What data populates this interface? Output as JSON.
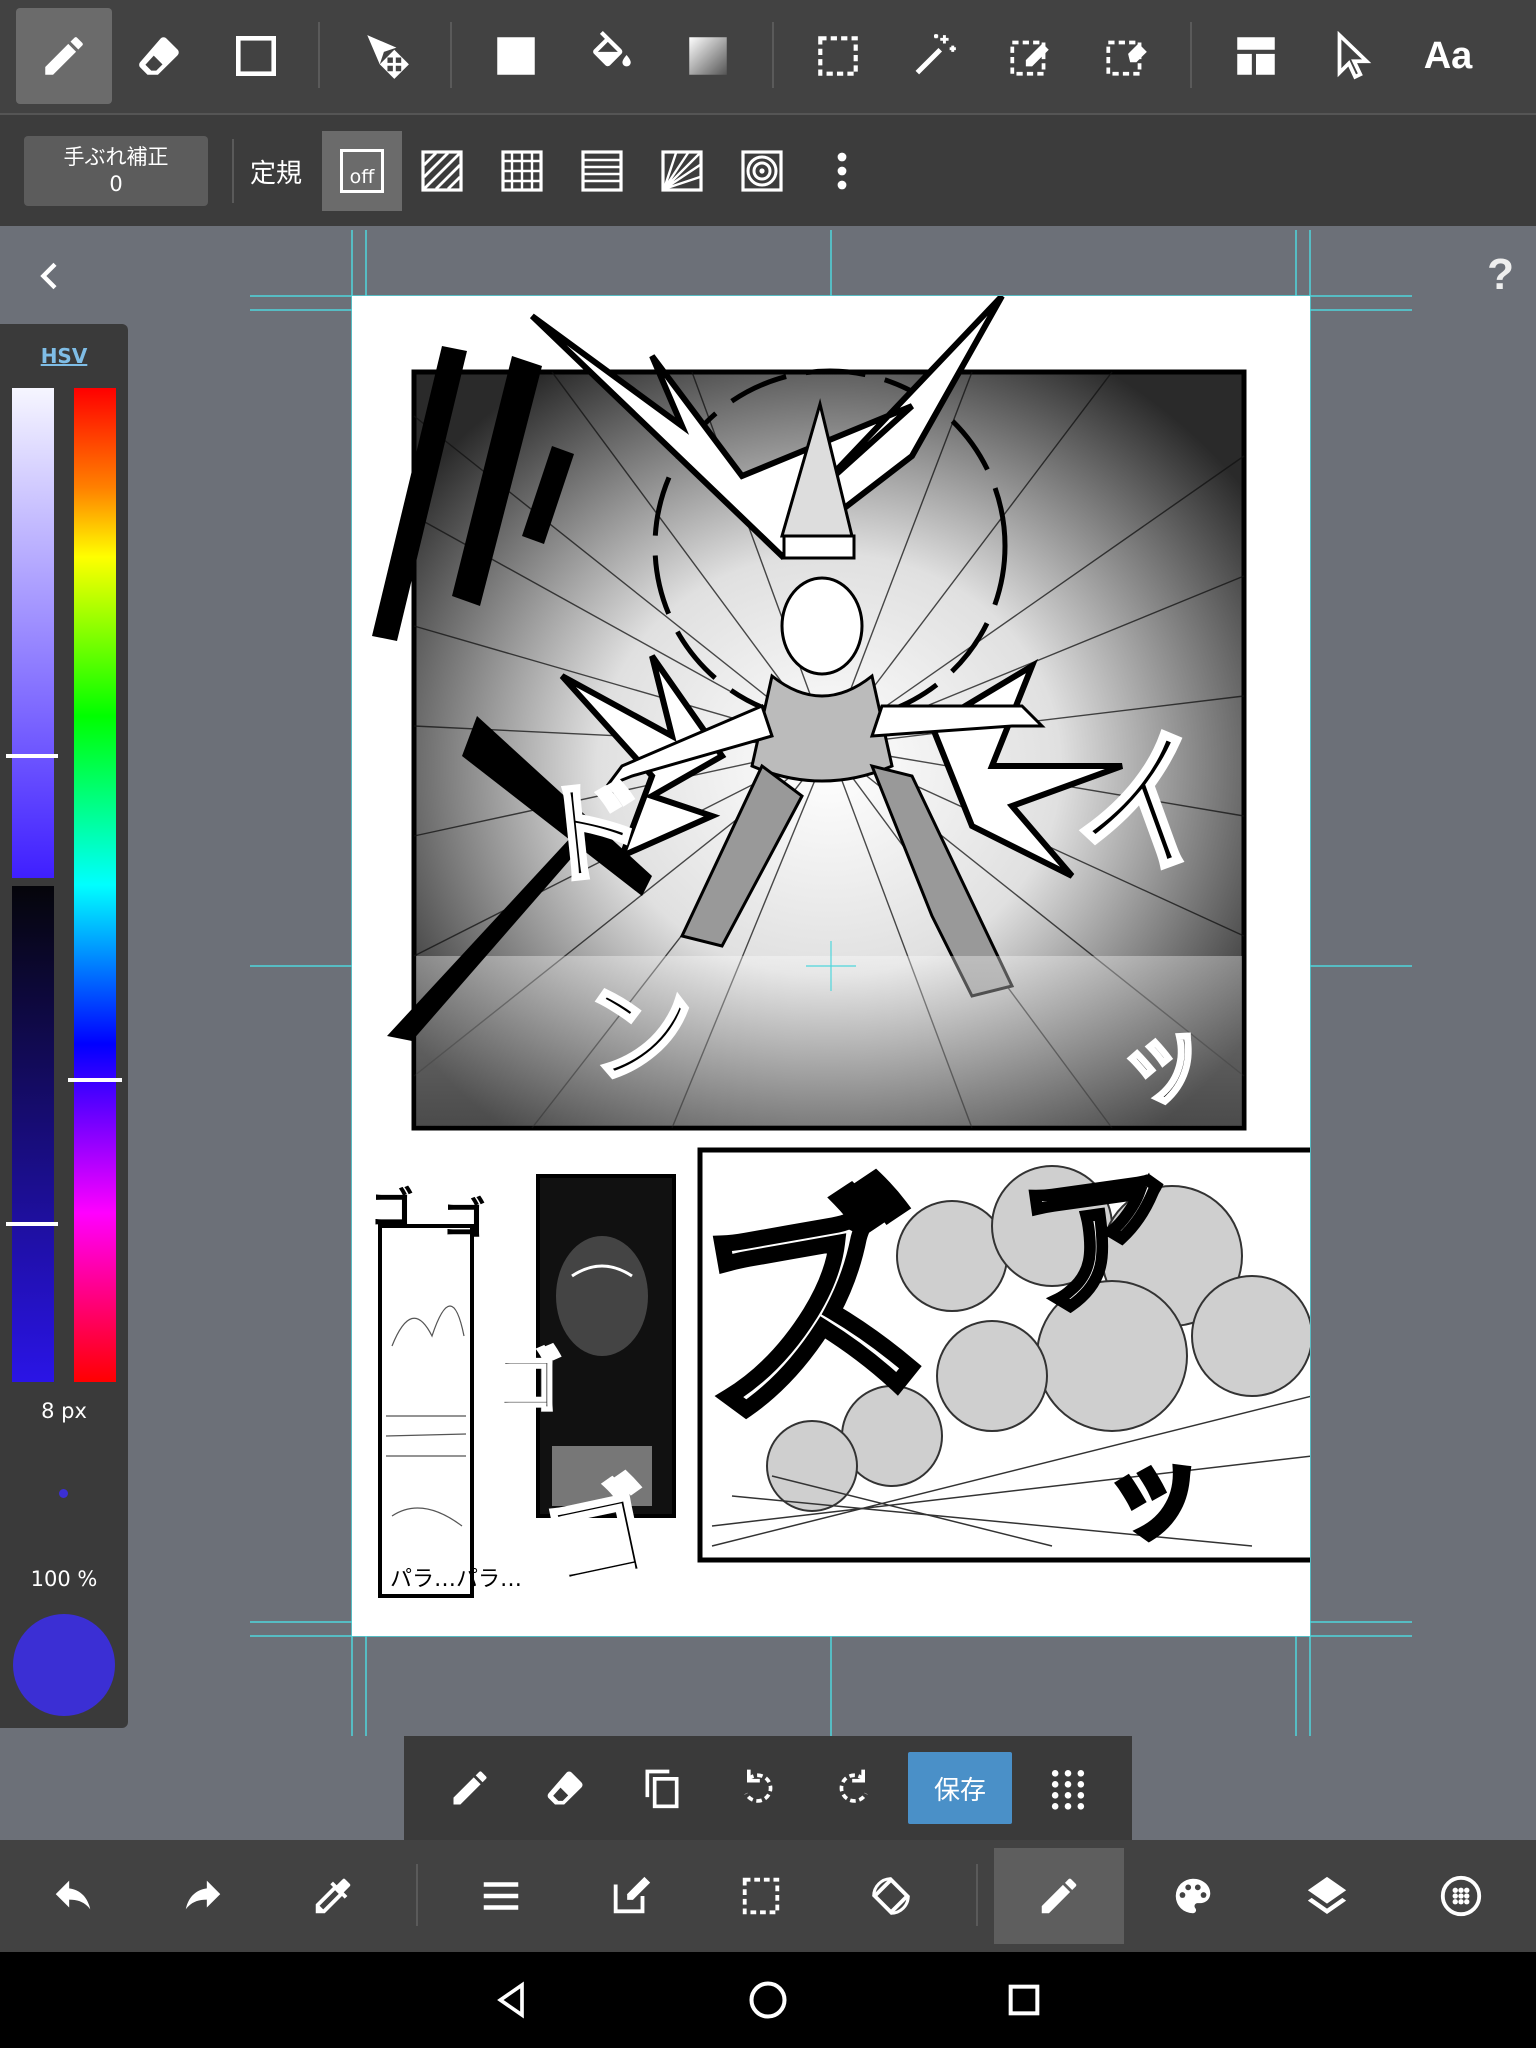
{
  "app": {
    "colors": {
      "toolbar_bg": "#424242",
      "subbar_bg": "#3c3c3c",
      "workspace_bg": "#6c7078",
      "guide": "#4fd6dc",
      "accent_save": "#4a90c8",
      "brush_color": "#3b2fd4"
    }
  },
  "top_toolbar": {
    "tools": [
      {
        "name": "pen",
        "icon": "pen-icon",
        "active": true
      },
      {
        "name": "eraser",
        "icon": "eraser-icon"
      },
      {
        "name": "shape",
        "icon": "rectangle-outline-icon"
      },
      {
        "name": "move",
        "icon": "move-icon"
      },
      {
        "name": "fill",
        "icon": "fill-rect-icon"
      },
      {
        "name": "bucket",
        "icon": "paint-bucket-icon"
      },
      {
        "name": "gradient",
        "icon": "gradient-icon"
      },
      {
        "name": "select",
        "icon": "selection-icon"
      },
      {
        "name": "magic wand",
        "icon": "magic-wand-icon"
      },
      {
        "name": "select pen",
        "icon": "select-pen-icon"
      },
      {
        "name": "select eraser",
        "icon": "select-eraser-icon"
      },
      {
        "name": "frame divider",
        "icon": "frame-divider-icon"
      },
      {
        "name": "operation",
        "icon": "pointer-icon"
      },
      {
        "name": "text",
        "icon": "text-icon"
      }
    ],
    "text_tool_label": "Aa"
  },
  "sub_toolbar": {
    "stabilizer_label": "手ぶれ補正",
    "stabilizer_value": "0",
    "ruler_label": "定規",
    "ruler_off_label": "off",
    "ruler_options": [
      "off",
      "parallel-lines",
      "grid",
      "horizontal-lines",
      "perspective",
      "concentric"
    ]
  },
  "color_panel": {
    "mode_label": "HSV",
    "brush_size_label": "8 px",
    "opacity_label": "100 %"
  },
  "quick_bar": {
    "items": [
      "pen-icon",
      "eraser-icon",
      "copy-icon",
      "undo-icon",
      "redo-icon",
      "save",
      "grid-menu-icon"
    ],
    "save_label": "保存"
  },
  "bottom_bar": {
    "items": [
      "undo-icon",
      "redo-icon",
      "eyedropper-icon",
      "menu-icon",
      "edit-icon",
      "selection-icon",
      "rotate-canvas-icon",
      "brush-icon",
      "palette-icon",
      "layers-icon",
      "material-icon"
    ],
    "active": "brush-icon"
  },
  "canvas": {
    "sfx_top": [
      "ド",
      "ン",
      "イ",
      "ッ"
    ],
    "sfx_bottom": [
      "ゴ",
      "ゴ",
      "ゴ",
      "ゴ",
      "ズ",
      "ア",
      "ッ"
    ],
    "small_panel_text": "パラ…パラ…"
  }
}
